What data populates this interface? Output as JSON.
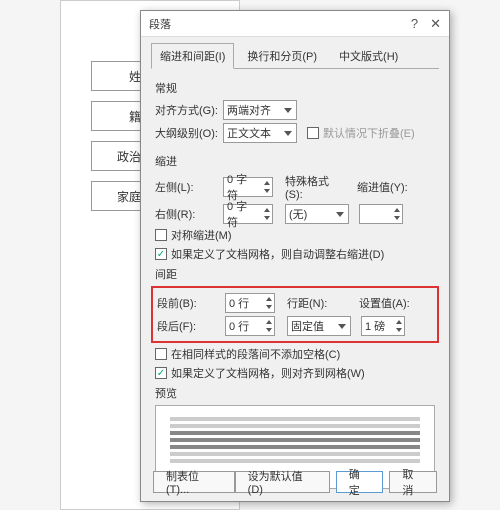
{
  "doc_cells": [
    "姓名",
    "籍贯",
    "政治面貌",
    "家庭住址"
  ],
  "dialog": {
    "title": "段落",
    "tabs": [
      "缩进和间距(I)",
      "换行和分页(P)",
      "中文版式(H)"
    ],
    "section_general": "常规",
    "align_label": "对齐方式(G):",
    "align_value": "两端对齐",
    "outline_label": "大纲级别(O):",
    "outline_value": "正文文本",
    "collapse_label": "默认情况下折叠(E)",
    "section_indent": "缩进",
    "left_label": "左侧(L):",
    "left_value": "0 字符",
    "right_label": "右侧(R):",
    "right_value": "0 字符",
    "special_label": "特殊格式(S):",
    "special_value": "(无)",
    "indent_val_label": "缩进值(Y):",
    "mirror_label": "对称缩进(M)",
    "auto_indent_label": "如果定义了文档网格，则自动调整右缩进(D)",
    "section_spacing": "间距",
    "before_label": "段前(B):",
    "before_value": "0 行",
    "after_label": "段后(F):",
    "after_value": "0 行",
    "line_spacing_label": "行距(N):",
    "line_spacing_value": "固定值",
    "set_value_label": "设置值(A):",
    "set_value": "1 磅",
    "no_space_label": "在相同样式的段落间不添加空格(C)",
    "snap_grid_label": "如果定义了文档网格，则对齐到网格(W)",
    "section_preview": "预览",
    "tabstops_btn": "制表位(T)...",
    "default_btn": "设为默认值(D)",
    "ok_btn": "确定",
    "cancel_btn": "取消"
  }
}
